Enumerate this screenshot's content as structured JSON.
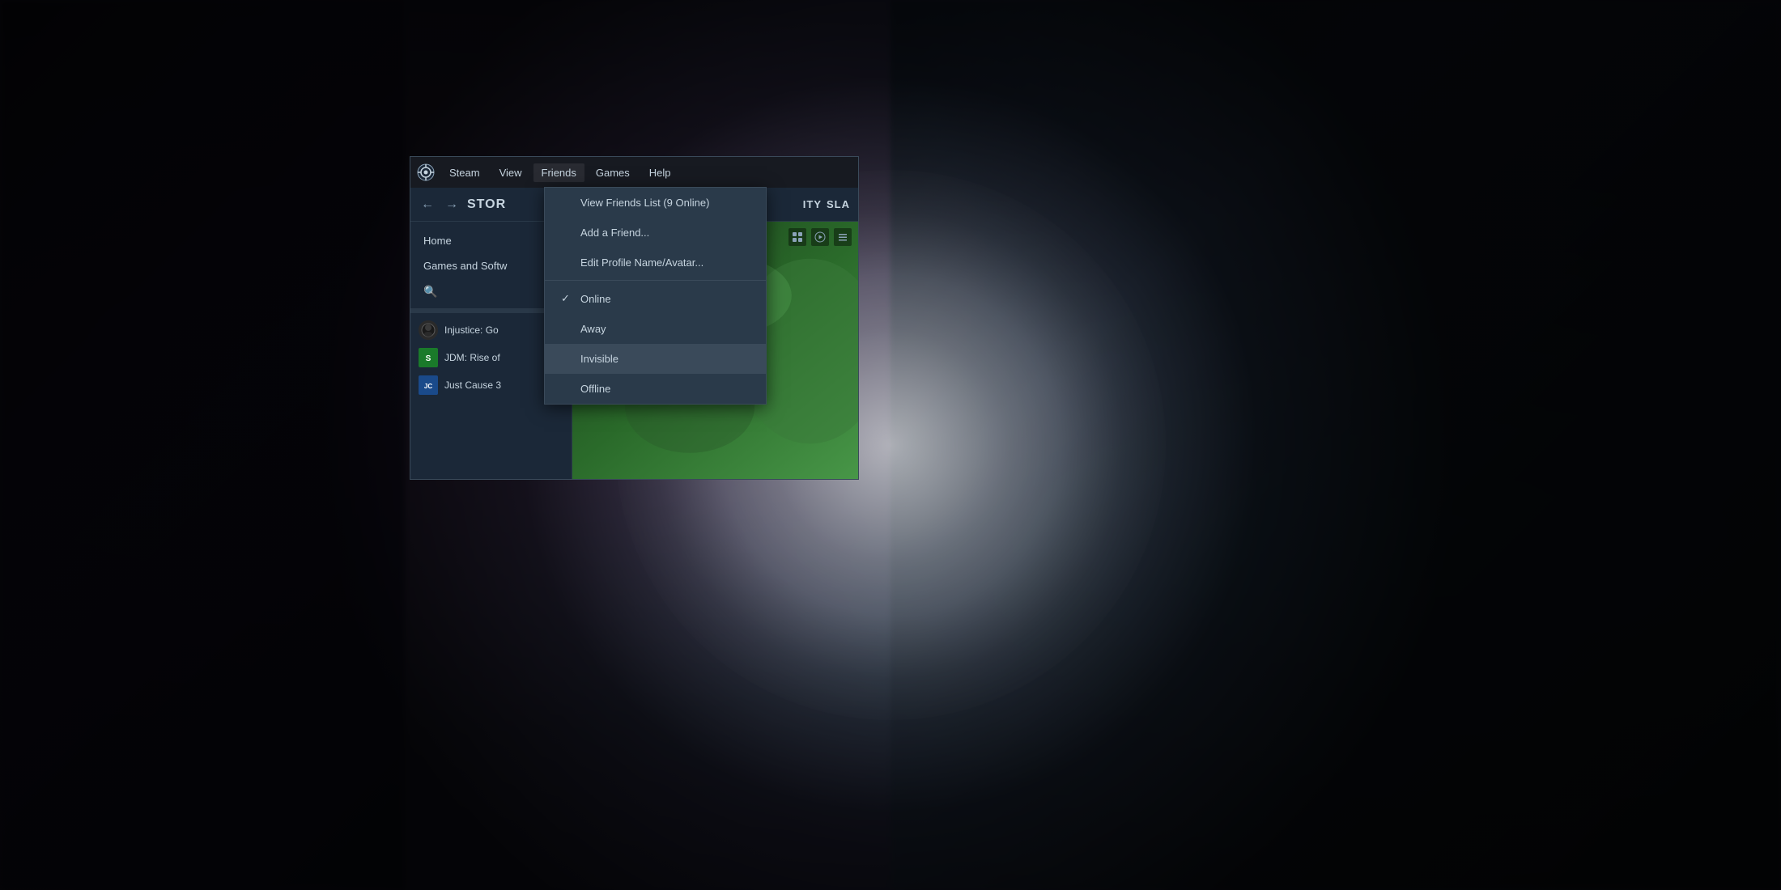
{
  "background": {
    "color": "#1c1c2e"
  },
  "steam_window": {
    "menu_bar": {
      "logo_alt": "Steam logo",
      "items": [
        {
          "label": "Steam",
          "id": "steam"
        },
        {
          "label": "View",
          "id": "view"
        },
        {
          "label": "Friends",
          "id": "friends",
          "active": true
        },
        {
          "label": "Games",
          "id": "games"
        },
        {
          "label": "Help",
          "id": "help"
        }
      ]
    },
    "nav_bar": {
      "back_icon": "←",
      "forward_icon": "→",
      "store_label": "STOR",
      "right_items": [
        "ITY",
        "SLA"
      ]
    },
    "sidebar": {
      "home_label": "Home",
      "games_label": "Games and Softw",
      "search_placeholder": "🔍",
      "games": [
        {
          "id": "injustice",
          "name": "Injustice: Go",
          "icon_text": "●",
          "icon_bg": "#2a2a3a"
        },
        {
          "id": "jdm",
          "name": "JDM: Rise of",
          "icon_text": "S",
          "icon_bg": "#1a8a3a"
        },
        {
          "id": "justcause",
          "name": "Just Cause 3",
          "icon_text": "JC",
          "icon_bg": "#1a4a8a"
        }
      ]
    },
    "main_content": {
      "banner_color_start": "#1a3a1a",
      "banner_color_end": "#4a8a4a"
    }
  },
  "dropdown": {
    "items": [
      {
        "id": "view-friends-list",
        "label": "View Friends List (9 Online)",
        "check": false,
        "highlighted": false
      },
      {
        "id": "add-friend",
        "label": "Add a Friend...",
        "check": false,
        "highlighted": false
      },
      {
        "id": "edit-profile",
        "label": "Edit Profile Name/Avatar...",
        "check": false,
        "highlighted": false
      },
      {
        "id": "online",
        "label": "Online",
        "check": true,
        "highlighted": false
      },
      {
        "id": "away",
        "label": "Away",
        "check": false,
        "highlighted": false
      },
      {
        "id": "invisible",
        "label": "Invisible",
        "check": false,
        "highlighted": true
      },
      {
        "id": "offline",
        "label": "Offline",
        "check": false,
        "highlighted": false
      }
    ]
  }
}
